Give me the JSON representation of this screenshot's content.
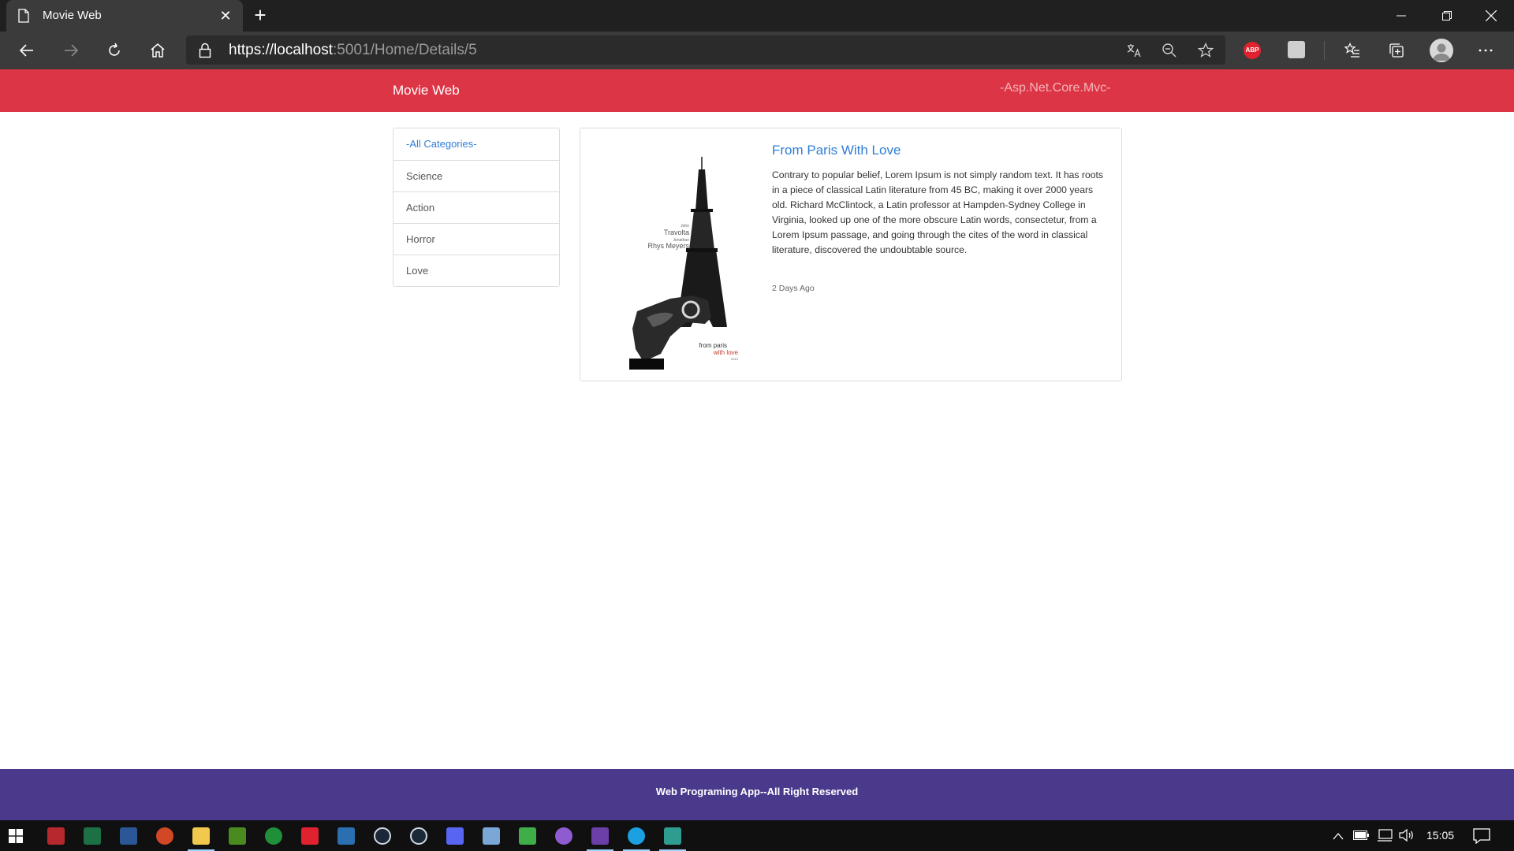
{
  "browser": {
    "tab_title": "Movie Web",
    "tab_close": "✕",
    "new_tab": "+",
    "url_host_prefix": "https://",
    "url_host": "localhost",
    "url_rest": ":5001/Home/Details/5",
    "extensions": {
      "abp_label": "ABP"
    }
  },
  "navbar": {
    "brand": "Movie Web",
    "tagline": "-Asp.Net.Core.Mvc-",
    "color": "#dc3545"
  },
  "sidebar": {
    "categories": [
      {
        "label": "-All Categories-",
        "active": true
      },
      {
        "label": "Science",
        "active": false
      },
      {
        "label": "Action",
        "active": false
      },
      {
        "label": "Horror",
        "active": false
      },
      {
        "label": "Love",
        "active": false
      }
    ]
  },
  "movie": {
    "title": "From Paris With Love",
    "description": "Contrary to popular belief, Lorem Ipsum is not simply random text. It has roots in a piece of classical Latin literature from 45 BC, making it over 2000 years old. Richard McClintock, a Latin professor at Hampden-Sydney College in Virginia, looked up one of the more obscure Latin words, consectetur, from a Lorem Ipsum passage, and going through the cites of the word in classical literature, discovered the undoubtable source.",
    "date": "2 Days Ago",
    "poster": {
      "actor1_first": "John",
      "actor1_last": "Travolta",
      "actor2_first": "Jonathan",
      "actor2_last": "Rhys Meyers",
      "title_line1": "from paris",
      "title_line2": "with love",
      "year": "2010"
    }
  },
  "footer": {
    "text": "Web Programing App--All Right Reserved",
    "color": "#4b3a8c"
  },
  "taskbar": {
    "clock": "15:05",
    "apps": [
      "windows-start",
      "access",
      "excel",
      "word",
      "powerpoint",
      "file-explorer",
      "nvidia",
      "razer",
      "lightning-app",
      "app-1",
      "steam",
      "steam",
      "discord",
      "app-2",
      "app-3",
      "app-4",
      "visual-studio",
      "edge",
      "app-5"
    ]
  }
}
